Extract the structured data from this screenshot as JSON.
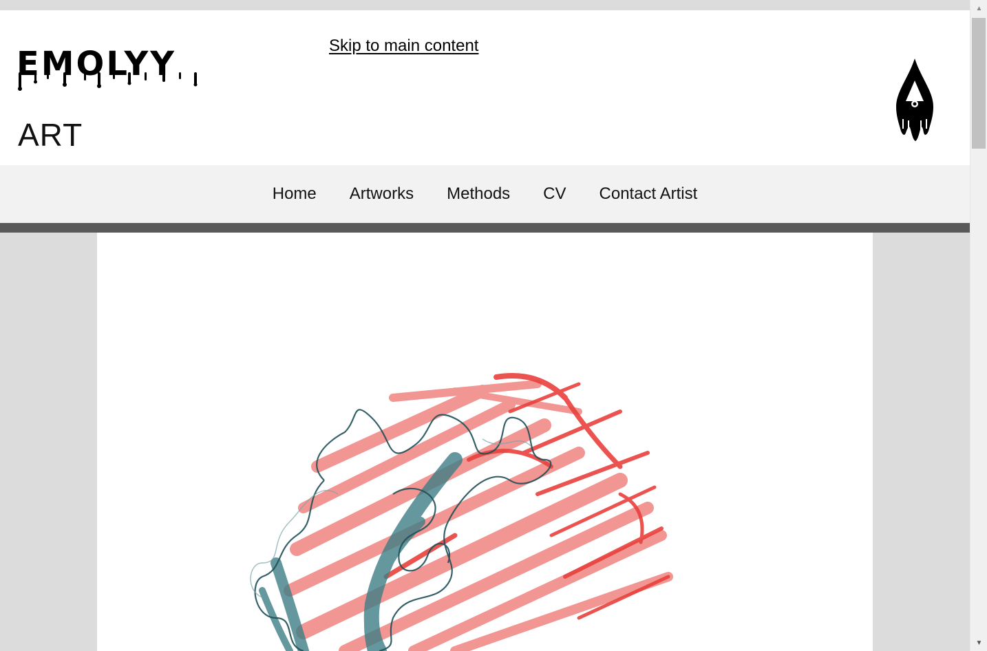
{
  "header": {
    "logo_text": "EMOLYY",
    "subtitle": "ART",
    "skip_link": "Skip to main content",
    "emblem_icon": "ink-drop-eye-icon"
  },
  "nav": {
    "items": [
      {
        "label": "Home"
      },
      {
        "label": "Artworks"
      },
      {
        "label": "Methods"
      },
      {
        "label": "CV"
      },
      {
        "label": "Contact Artist"
      }
    ]
  },
  "main": {
    "artwork_icon": "abstract-red-teal-artwork"
  },
  "colors": {
    "page_bg": "#dcdcdc",
    "header_bg": "#ffffff",
    "nav_bg": "#f2f2f2",
    "nav_bar": "#595959",
    "art_red": "#e8413c",
    "art_teal": "#3e7f86"
  },
  "scrollbar": {
    "up_icon": "scroll-up-arrow-icon",
    "down_icon": "scroll-down-arrow-icon"
  }
}
